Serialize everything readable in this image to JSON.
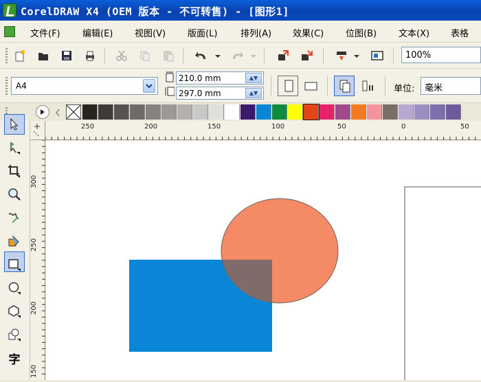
{
  "window": {
    "title": "CorelDRAW X4 (OEM 版本 - 不可转售) - [图形1]"
  },
  "menu": {
    "items": [
      {
        "label": "文件(F)"
      },
      {
        "label": "编辑(E)"
      },
      {
        "label": "视图(V)"
      },
      {
        "label": "版面(L)"
      },
      {
        "label": "排列(A)"
      },
      {
        "label": "效果(C)"
      },
      {
        "label": "位图(B)"
      },
      {
        "label": "文本(X)"
      },
      {
        "label": "表格"
      }
    ]
  },
  "toolbar": {
    "icons": [
      "new-icon",
      "open-icon",
      "save-icon",
      "print-icon",
      "cut-icon",
      "copy-icon",
      "paste-icon",
      "undo-icon",
      "redo-icon",
      "import-icon",
      "export-icon",
      "app-launcher-icon",
      "welcome-screen-icon"
    ],
    "zoom": "100%"
  },
  "property_bar": {
    "page_size": "A4",
    "width": "210.0 mm",
    "height": "297.0 mm",
    "unit_label": "单位:",
    "unit_value": "毫米"
  },
  "palette": {
    "colors": [
      "#2a241f",
      "#3e3a37",
      "#575350",
      "#6e6b69",
      "#858382",
      "#9c9a99",
      "#b3b1b0",
      "#c9c8c8",
      "#e0dfdf",
      "#ffffff",
      "#3b1a6e",
      "#0a86d8",
      "#0f8b3e",
      "#ffff00",
      "#e34516",
      "#e8216c",
      "#a04a8d",
      "#f47c20",
      "#f4939e",
      "#7a6e67",
      "#b9a8d1",
      "#9a8fc1",
      "#7b6fad",
      "#6c5a9c"
    ]
  },
  "rulers": {
    "top_labels": [
      "250",
      "200",
      "150",
      "100",
      "50",
      "0",
      "50"
    ],
    "left_labels": [
      "300",
      "250",
      "200",
      "150"
    ]
  },
  "tools": [
    "pick-tool-icon",
    "shape-tool-icon",
    "crop-tool-icon",
    "zoom-tool-icon",
    "freehand-tool-icon",
    "smart-fill-tool-icon",
    "rectangle-tool-icon",
    "ellipse-tool-icon",
    "polygon-tool-icon",
    "basic-shapes-tool-icon",
    "text-tool-icon"
  ],
  "text_tool_glyph": "字",
  "canvas_shapes": {
    "rectangle": {
      "fill": "#0a86d8"
    },
    "ellipse": {
      "fill": "#f58b66"
    },
    "overlap": {
      "fill": "#7e6b6a"
    }
  }
}
